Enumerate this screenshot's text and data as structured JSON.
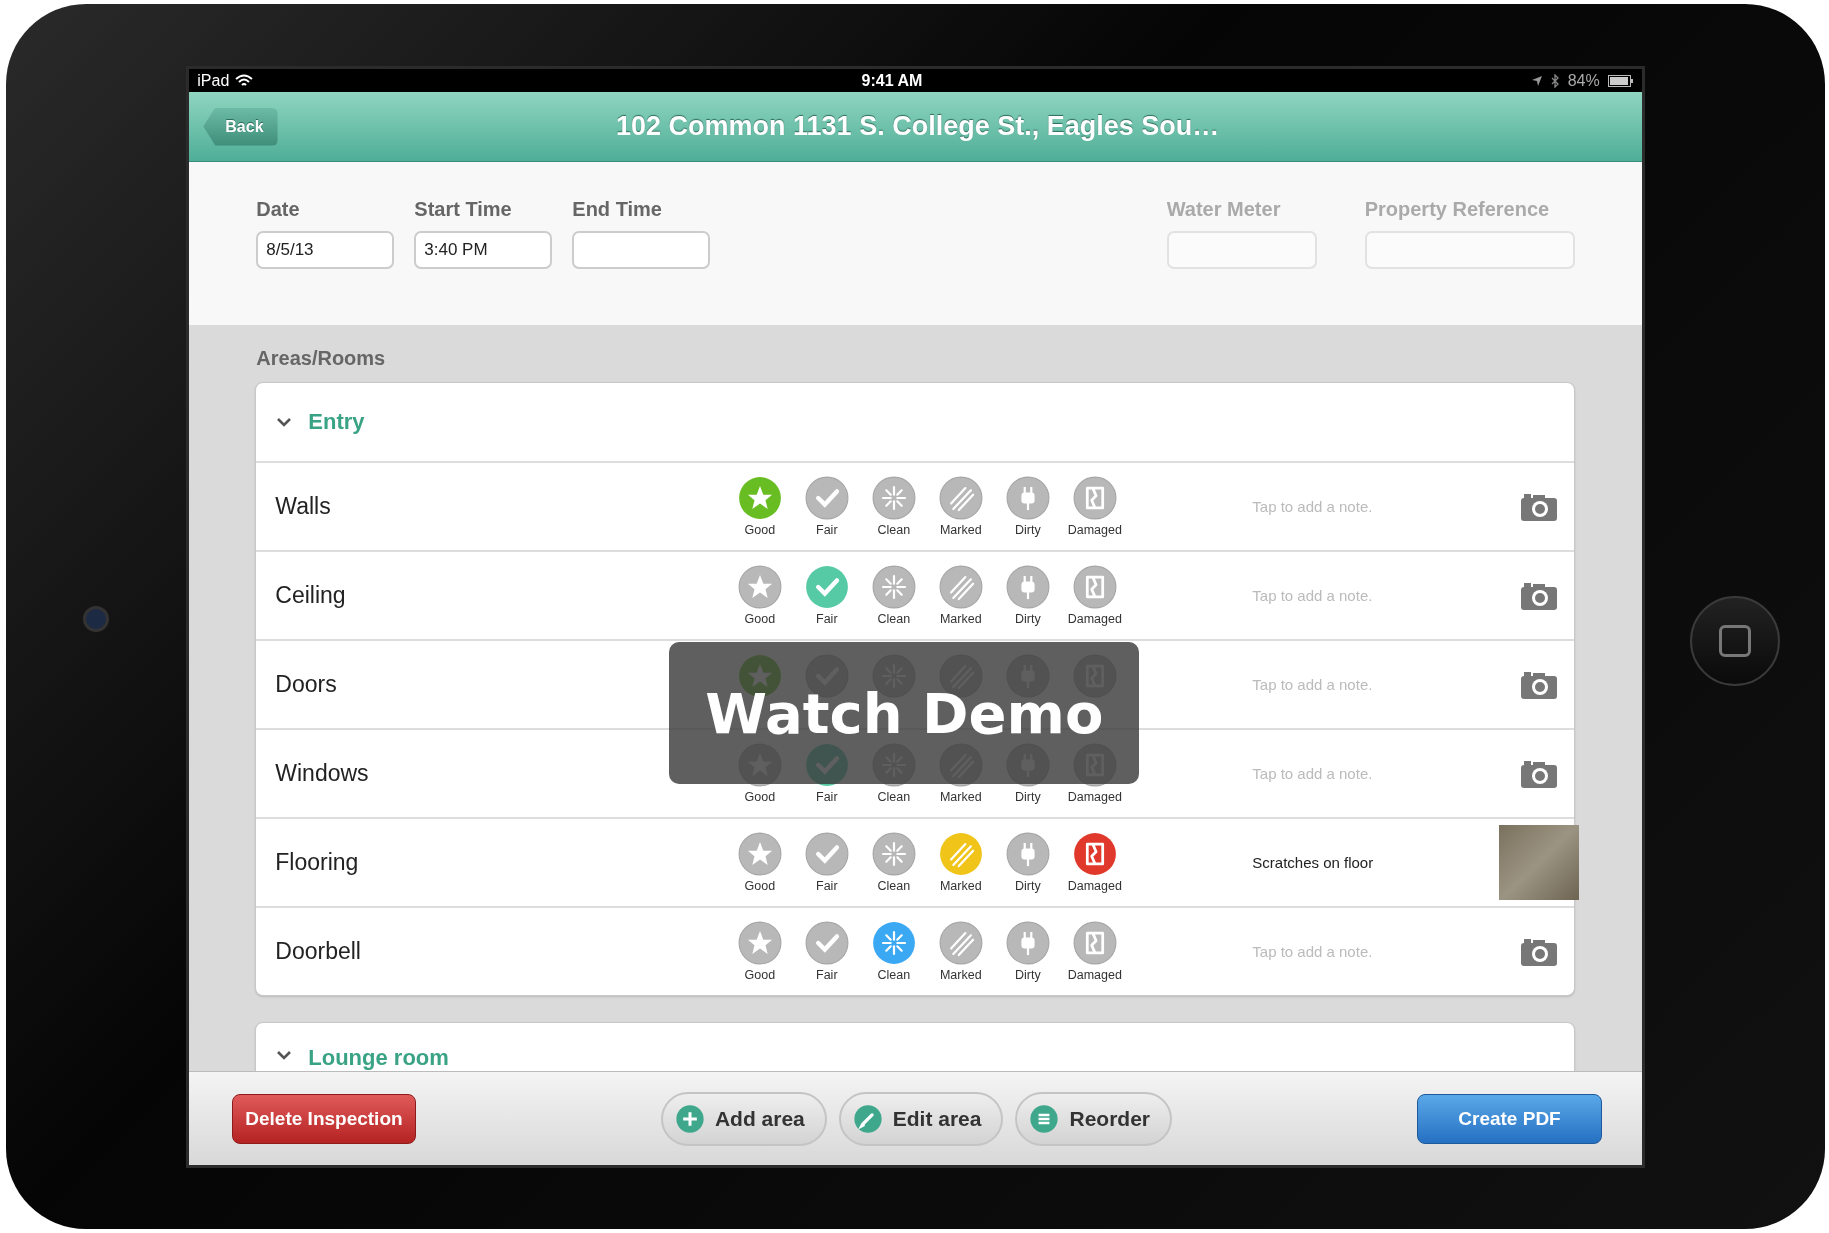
{
  "status_bar": {
    "carrier": "iPad",
    "time": "9:41 AM",
    "battery": "84%"
  },
  "nav": {
    "back": "Back",
    "title": "102 Common 1131 S. College St., Eagles Sou…"
  },
  "fields": [
    {
      "label": "Date",
      "value": "8/5/13",
      "disabled": false
    },
    {
      "label": "Start Time",
      "value": "3:40 PM",
      "disabled": false
    },
    {
      "label": "End Time",
      "disabled": false
    },
    {
      "label": "Water Meter",
      "disabled": true
    },
    {
      "label": "Property Reference",
      "disabled": true
    }
  ],
  "section_label": "Areas/Rooms",
  "areas": [
    {
      "name": "Entry",
      "expanded": true,
      "items": [
        {
          "name": "Walls",
          "ratings": [
            {
              "kind": "good",
              "label": "Good",
              "selected": true
            },
            {
              "kind": "fair",
              "label": "Fair",
              "selected": false
            },
            {
              "kind": "clean",
              "label": "Clean",
              "selected": false
            },
            {
              "kind": "marked",
              "label": "Marked",
              "selected": false
            },
            {
              "kind": "dirty",
              "label": "Dirty",
              "selected": false
            },
            {
              "kind": "damaged",
              "label": "Damaged",
              "selected": false
            }
          ],
          "note": {
            "placeholder": "Tap to add a note."
          },
          "photo": false
        },
        {
          "name": "Ceiling",
          "ratings": [
            {
              "kind": "good",
              "label": "Good",
              "selected": false
            },
            {
              "kind": "fair",
              "label": "Fair",
              "selected": true
            },
            {
              "kind": "clean",
              "label": "Clean",
              "selected": false
            },
            {
              "kind": "marked",
              "label": "Marked",
              "selected": false
            },
            {
              "kind": "dirty",
              "label": "Dirty",
              "selected": false
            },
            {
              "kind": "damaged",
              "label": "Damaged",
              "selected": false
            }
          ],
          "note": {
            "placeholder": "Tap to add a note."
          },
          "photo": false
        },
        {
          "name": "Doors",
          "ratings": [
            {
              "kind": "good",
              "selected": true
            },
            {
              "kind": "fair",
              "selected": false
            },
            {
              "kind": "clean",
              "selected": false
            },
            {
              "kind": "marked",
              "selected": false
            },
            {
              "kind": "dirty",
              "selected": false
            },
            {
              "kind": "damaged",
              "selected": false
            }
          ],
          "note": {
            "placeholder": "Tap to add a note."
          },
          "photo": false
        },
        {
          "name": "Windows",
          "ratings": [
            {
              "kind": "good",
              "label": "Good",
              "selected": false
            },
            {
              "kind": "fair",
              "label": "Fair",
              "selected": true
            },
            {
              "kind": "clean",
              "label": "Clean",
              "selected": false
            },
            {
              "kind": "marked",
              "label": "Marked",
              "selected": false
            },
            {
              "kind": "dirty",
              "label": "Dirty",
              "selected": false
            },
            {
              "kind": "damaged",
              "label": "Damaged",
              "selected": false
            }
          ],
          "note": {
            "placeholder": "Tap to add a note."
          },
          "photo": false
        },
        {
          "name": "Flooring",
          "ratings": [
            {
              "kind": "good",
              "label": "Good",
              "selected": false
            },
            {
              "kind": "fair",
              "label": "Fair",
              "selected": false
            },
            {
              "kind": "clean",
              "label": "Clean",
              "selected": false
            },
            {
              "kind": "marked",
              "label": "Marked",
              "selected": true
            },
            {
              "kind": "dirty",
              "label": "Dirty",
              "selected": false
            },
            {
              "kind": "damaged",
              "label": "Damaged",
              "selected": true
            }
          ],
          "note": {
            "value": "Scratches on floor"
          },
          "photo": true
        },
        {
          "name": "Doorbell",
          "ratings": [
            {
              "kind": "good",
              "label": "Good",
              "selected": false
            },
            {
              "kind": "fair",
              "label": "Fair",
              "selected": false
            },
            {
              "kind": "clean",
              "label": "Clean",
              "selected": true
            },
            {
              "kind": "marked",
              "label": "Marked",
              "selected": false
            },
            {
              "kind": "dirty",
              "label": "Dirty",
              "selected": false
            },
            {
              "kind": "damaged",
              "label": "Damaged",
              "selected": false
            }
          ],
          "note": {
            "placeholder": "Tap to add a note."
          },
          "photo": false
        }
      ]
    },
    {
      "name": "Lounge room",
      "expanded": true
    }
  ],
  "overlay": {
    "label": "Watch Demo"
  },
  "toolbar": {
    "delete": "Delete Inspection",
    "actions": [
      {
        "kind": "add",
        "label": "Add area"
      },
      {
        "kind": "edit",
        "label": "Edit area"
      },
      {
        "kind": "reorder",
        "label": "Reorder"
      }
    ],
    "create": "Create PDF"
  }
}
